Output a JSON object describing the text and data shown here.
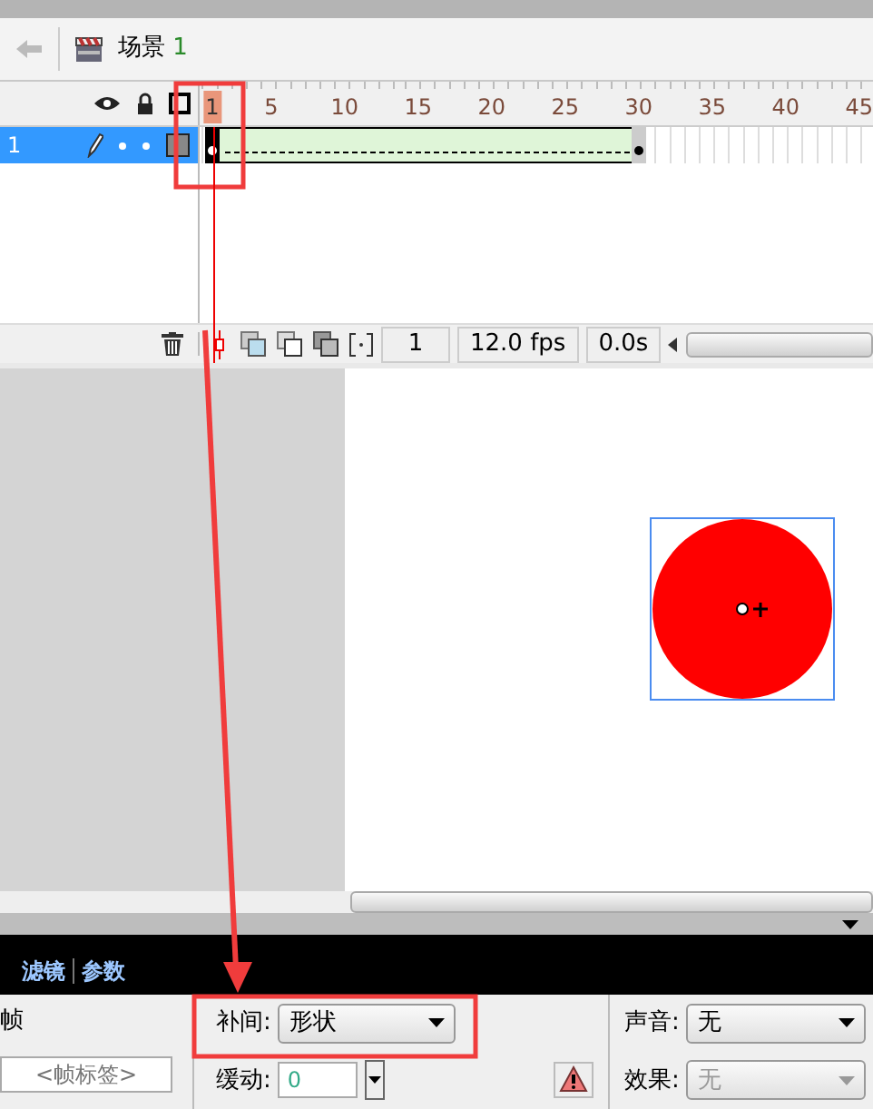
{
  "scene_bar": {
    "scene_label": "场景",
    "scene_number": "1"
  },
  "timeline": {
    "ruler": [
      "1",
      "5",
      "10",
      "15",
      "20",
      "25",
      "30",
      "35",
      "40",
      "45"
    ],
    "layers": [
      {
        "name": "1",
        "selected": true
      }
    ],
    "tween": {
      "kind": "shape"
    },
    "footer": {
      "current_frame": "1",
      "frame_rate": "12.0 fps",
      "elapsed": "0.0s"
    }
  },
  "stage": {
    "shape": {
      "kind": "circle",
      "color": "#ff0000",
      "selected": true
    }
  },
  "properties": {
    "tabs": [
      {
        "label": "滤镜"
      },
      {
        "label": "参数"
      }
    ],
    "frame_heading": "帧",
    "frame_label_placeholder": "<帧标签>",
    "tween": {
      "label": "补间:",
      "value": "形状"
    },
    "ease": {
      "label": "缓动:",
      "value": "0"
    },
    "sound": {
      "label": "声音:",
      "value": "无",
      "disabled": false
    },
    "effect": {
      "label": "效果:",
      "value": "无",
      "disabled": true
    }
  },
  "annotations": [
    {
      "kind": "box"
    },
    {
      "kind": "box"
    },
    {
      "kind": "arrow"
    }
  ]
}
